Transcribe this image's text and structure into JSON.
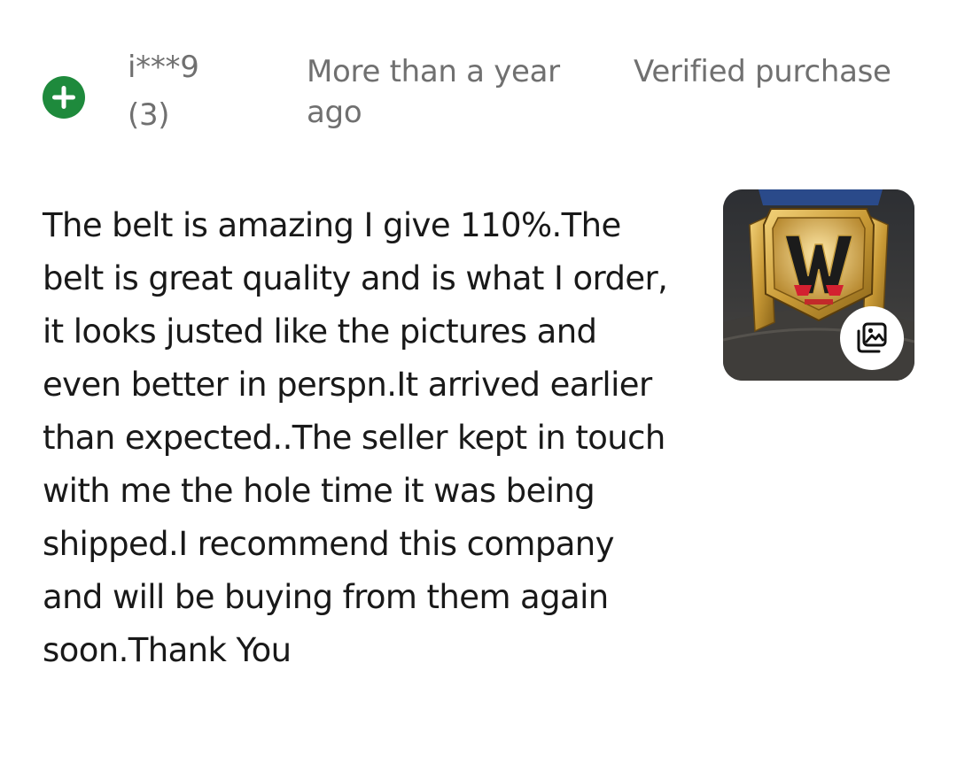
{
  "review": {
    "user": {
      "name": "i***9",
      "rating_count": "(3)"
    },
    "feedback_icon": "plus-circle-icon",
    "feedback_color": "#1e8a3c",
    "time": "More than a year ago",
    "verified": "Verified purchase",
    "text": "The belt is amazing I give 110%.The belt is great quality and is what I order, it looks justed like the pictures and even better in perspn.It arrived earlier than expected..The seller kept in touch with me the hole time it was being shipped.I recommend this company and will be buying from them again soon.Thank You",
    "photo": {
      "alt_subject": "championship belt photo",
      "badge_icon": "image-gallery-icon"
    }
  }
}
